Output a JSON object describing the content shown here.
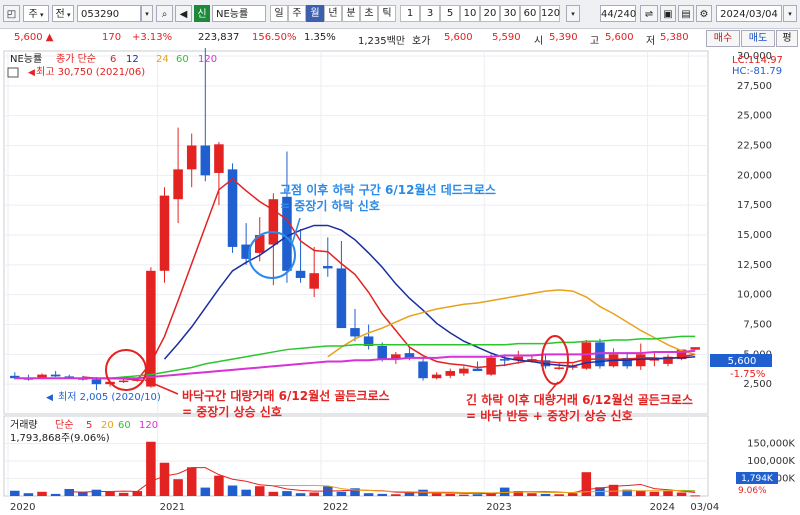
{
  "toolbar": {
    "market_label": "주",
    "total_label": "전",
    "stock_code": "053290",
    "new_label": "신",
    "stock_name": "NE능률",
    "periods": [
      "일",
      "주",
      "월",
      "년",
      "분",
      "초",
      "틱"
    ],
    "active_period": "월",
    "intervals": [
      "1",
      "3",
      "5",
      "10",
      "20",
      "30",
      "60",
      "120"
    ],
    "count_label": "44/240",
    "date_label": "2024/03/04"
  },
  "quote": {
    "price": "5,600 ▲",
    "change": "170",
    "change_pct": "+3.13%",
    "volume": "223,837",
    "volume_pct": "156.50%",
    "turnover_pct": "1.35%",
    "amount": "1,235백만",
    "bid_label": "호가",
    "bid1": "5,600",
    "bid2": "5,590",
    "open_label": "시",
    "open": "5,390",
    "high_label": "고",
    "high": "5,600",
    "low_label": "저",
    "low": "5,380",
    "buy_label": "매수",
    "sell_label": "매도",
    "ask_label": "평"
  },
  "price_panel": {
    "legend_name": "NE능률",
    "legend_ma": "종가 단순",
    "ma_labels": [
      "6",
      "12",
      "24",
      "60",
      "120"
    ],
    "max_label": "최고 30,750 (2021/06)",
    "min_label": "최저 2,005 (2020/10)",
    "lc_label": "LC:114.97",
    "hc_label": "HC:-81.79",
    "current_price_label": "5,600",
    "current_pct_label": "-1.75%"
  },
  "volume_panel": {
    "title": "거래량",
    "ma_type": "단순",
    "ma_labels": [
      "5",
      "20",
      "60",
      "120"
    ],
    "current_label": "1,793,868주(9.06%)",
    "current_tag": "1,794K",
    "current_pct_tag": "9.06%"
  },
  "annotations": {
    "top_line1": "고점 이후 하락 구간 6/12월선 데드크로스",
    "top_line2": "= 중장기 하락 신호",
    "left_line1": "바닥구간 대량거래 6/12월선 골든크로스",
    "left_line2": "= 중장기 상승 신호",
    "right_line1": "긴 하락 이후 대량거래 6/12월선 골든크로스",
    "right_line2": "= 바닥 반등 + 중장기 상승 신호"
  },
  "colors": {
    "up": "#e32222",
    "down": "#1f5fd0",
    "ma6": "#e32222",
    "ma12": "#1a2fa0",
    "ma24": "#e8a21a",
    "ma60": "#2cc52c",
    "ma120": "#d632d6",
    "annotation_blue": "#2b8ae8",
    "annotation_red": "#e32222"
  },
  "chart_data": {
    "type": "candlestick",
    "interval": "monthly",
    "price_ylim": [
      0,
      30000
    ],
    "price_yticks": [
      "2,500",
      "5,000",
      "7,500",
      "10,000",
      "12,500",
      "15,000",
      "17,500",
      "20,000",
      "22,500",
      "25,000",
      "27,500",
      "30,000"
    ],
    "price_yticks_values": [
      2500,
      5000,
      7500,
      10000,
      12500,
      15000,
      17500,
      20000,
      22500,
      25000,
      27500,
      30000
    ],
    "volume_yticks": [
      "50,000K",
      "100,000K",
      "150,000K"
    ],
    "volume_yticks_values": [
      50000,
      100000,
      150000
    ],
    "volume_ylim": [
      0,
      160000
    ],
    "x_labels": [
      "2020",
      "2021",
      "2022",
      "2023",
      "2024",
      "03/04"
    ],
    "x_label_index": [
      0,
      11,
      23,
      35,
      47,
      50
    ],
    "candles": [
      {
        "o": 3200,
        "h": 3500,
        "l": 2900,
        "c": 3000
      },
      {
        "o": 3000,
        "h": 3300,
        "l": 2800,
        "c": 2950
      },
      {
        "o": 2950,
        "h": 3400,
        "l": 2900,
        "c": 3300
      },
      {
        "o": 3300,
        "h": 3600,
        "l": 3100,
        "c": 3150
      },
      {
        "o": 3150,
        "h": 3300,
        "l": 2950,
        "c": 3000
      },
      {
        "o": 3000,
        "h": 3200,
        "l": 2800,
        "c": 2900
      },
      {
        "o": 2900,
        "h": 3100,
        "l": 2005,
        "c": 2500
      },
      {
        "o": 2500,
        "h": 2800,
        "l": 2300,
        "c": 2700
      },
      {
        "o": 2700,
        "h": 3000,
        "l": 2600,
        "c": 2800
      },
      {
        "o": 2800,
        "h": 3000,
        "l": 2700,
        "c": 2900
      },
      {
        "o": 2300,
        "h": 12300,
        "l": 2200,
        "c": 12000
      },
      {
        "o": 12000,
        "h": 19000,
        "l": 11000,
        "c": 18300
      },
      {
        "o": 18000,
        "h": 24000,
        "l": 16000,
        "c": 20500
      },
      {
        "o": 20500,
        "h": 23500,
        "l": 19000,
        "c": 22500
      },
      {
        "o": 22500,
        "h": 30750,
        "l": 19500,
        "c": 20000
      },
      {
        "o": 20200,
        "h": 22800,
        "l": 17500,
        "c": 22600
      },
      {
        "o": 20500,
        "h": 21000,
        "l": 13500,
        "c": 14000
      },
      {
        "o": 14200,
        "h": 16000,
        "l": 12500,
        "c": 13000
      },
      {
        "o": 13500,
        "h": 16500,
        "l": 12800,
        "c": 15000
      },
      {
        "o": 14200,
        "h": 18500,
        "l": 10800,
        "c": 18000
      },
      {
        "o": 18200,
        "h": 22000,
        "l": 11000,
        "c": 12000
      },
      {
        "o": 12000,
        "h": 15500,
        "l": 11000,
        "c": 11400
      },
      {
        "o": 10500,
        "h": 14000,
        "l": 9800,
        "c": 11800
      },
      {
        "o": 12400,
        "h": 14800,
        "l": 11500,
        "c": 12200
      },
      {
        "o": 12200,
        "h": 14500,
        "l": 11000,
        "c": 7200
      },
      {
        "o": 7200,
        "h": 8800,
        "l": 6100,
        "c": 6500
      },
      {
        "o": 6500,
        "h": 7500,
        "l": 5400,
        "c": 5700
      },
      {
        "o": 5700,
        "h": 6000,
        "l": 4400,
        "c": 4600
      },
      {
        "o": 4600,
        "h": 5200,
        "l": 4200,
        "c": 5000
      },
      {
        "o": 5100,
        "h": 5600,
        "l": 4500,
        "c": 4700
      },
      {
        "o": 4400,
        "h": 4800,
        "l": 2800,
        "c": 3000
      },
      {
        "o": 3000,
        "h": 3500,
        "l": 2900,
        "c": 3300
      },
      {
        "o": 3200,
        "h": 3800,
        "l": 3000,
        "c": 3600
      },
      {
        "o": 3400,
        "h": 4000,
        "l": 3200,
        "c": 3800
      },
      {
        "o": 3800,
        "h": 4400,
        "l": 3600,
        "c": 3600
      },
      {
        "o": 3300,
        "h": 5000,
        "l": 3200,
        "c": 4700
      },
      {
        "o": 4600,
        "h": 5000,
        "l": 4000,
        "c": 4500
      },
      {
        "o": 4500,
        "h": 5300,
        "l": 4200,
        "c": 4800
      },
      {
        "o": 4600,
        "h": 5000,
        "l": 4300,
        "c": 4600
      },
      {
        "o": 4500,
        "h": 5000,
        "l": 3800,
        "c": 4000
      },
      {
        "o": 3900,
        "h": 4300,
        "l": 3700,
        "c": 3900
      },
      {
        "o": 3900,
        "h": 4200,
        "l": 3700,
        "c": 4000
      },
      {
        "o": 3800,
        "h": 6200,
        "l": 3700,
        "c": 6000
      },
      {
        "o": 6000,
        "h": 6300,
        "l": 3800,
        "c": 4000
      },
      {
        "o": 4000,
        "h": 5500,
        "l": 3900,
        "c": 5000
      },
      {
        "o": 4700,
        "h": 5200,
        "l": 3800,
        "c": 4000
      },
      {
        "o": 4000,
        "h": 5900,
        "l": 3700,
        "c": 5000
      },
      {
        "o": 4500,
        "h": 5200,
        "l": 4000,
        "c": 4600
      },
      {
        "o": 4200,
        "h": 5000,
        "l": 4000,
        "c": 4800
      },
      {
        "o": 4600,
        "h": 5000,
        "l": 4500,
        "c": 5400
      },
      {
        "o": 5390,
        "h": 5600,
        "l": 5380,
        "c": 5600
      }
    ],
    "volume": [
      15,
      8,
      12,
      6,
      20,
      10,
      18,
      12,
      9,
      14,
      155,
      95,
      48,
      82,
      24,
      58,
      30,
      18,
      28,
      12,
      14,
      8,
      10,
      28,
      12,
      22,
      8,
      6,
      5,
      9,
      18,
      7,
      6,
      4,
      5,
      10,
      24,
      14,
      8,
      6,
      5,
      8,
      68,
      25,
      32,
      18,
      15,
      12,
      14,
      10,
      1.8
    ],
    "ma_series": [
      {
        "name": "6",
        "values": [
          null,
          null,
          null,
          null,
          null,
          3100,
          3000,
          2950,
          2950,
          2850,
          4300,
          6500,
          9500,
          12600,
          15700,
          18800,
          19700,
          18700,
          17800,
          17100,
          16300,
          14500,
          13700,
          13600,
          12600,
          11700,
          10200,
          8400,
          7000,
          5600,
          4900,
          4400,
          4200,
          4100,
          3900,
          4000,
          4100,
          4300,
          4500,
          4400,
          4300,
          4300,
          4600,
          4600,
          4600,
          4600,
          4700,
          4700,
          4600,
          4800,
          5000
        ]
      },
      {
        "name": "12",
        "values": [
          null,
          null,
          null,
          null,
          null,
          null,
          null,
          null,
          null,
          null,
          null,
          4600,
          5900,
          7300,
          8900,
          10500,
          12000,
          12700,
          13300,
          14100,
          14900,
          15400,
          15800,
          15800,
          15400,
          14600,
          13500,
          12300,
          10900,
          9700,
          8700,
          7600,
          6800,
          6100,
          5600,
          5100,
          4700,
          4500,
          4400,
          4200,
          4100,
          4000,
          4300,
          4400,
          4500,
          4500,
          4600,
          4600,
          4700,
          4700,
          4800
        ]
      },
      {
        "name": "24",
        "values": [
          null,
          null,
          null,
          null,
          null,
          null,
          null,
          null,
          null,
          null,
          null,
          null,
          null,
          null,
          null,
          null,
          null,
          null,
          null,
          null,
          null,
          null,
          null,
          4800,
          5600,
          6300,
          6800,
          7200,
          7700,
          8200,
          8500,
          8800,
          9000,
          9200,
          9300,
          9500,
          9700,
          9900,
          10100,
          10300,
          10400,
          10300,
          9800,
          9000,
          8400,
          7700,
          7000,
          6400,
          5800,
          5300,
          5000
        ]
      },
      {
        "name": "60",
        "values": [
          null,
          null,
          null,
          null,
          null,
          null,
          3000,
          3000,
          3100,
          3200,
          3300,
          3500,
          3700,
          3900,
          4200,
          4400,
          4600,
          4800,
          5000,
          5200,
          5400,
          5500,
          5600,
          5700,
          5700,
          5800,
          5800,
          5800,
          5800,
          5800,
          5800,
          5800,
          5800,
          5800,
          5800,
          5800,
          5800,
          5900,
          5900,
          5900,
          6000,
          6000,
          6100,
          6100,
          6200,
          6200,
          6300,
          6300,
          6400,
          6500,
          6500
        ]
      },
      {
        "name": "120",
        "values": [
          3000,
          3000,
          3000,
          3000,
          3000,
          3000,
          3000,
          3000,
          3000,
          3000,
          3100,
          3200,
          3300,
          3400,
          3500,
          3600,
          3700,
          3800,
          3900,
          4000,
          4100,
          4200,
          4300,
          4400,
          4400,
          4500,
          4500,
          4600,
          4600,
          4700,
          4700,
          4700,
          4800,
          4800,
          4800,
          4800,
          4900,
          4900,
          4900,
          5000,
          5000,
          5000,
          5000,
          5100,
          5100,
          5100,
          5100,
          5200,
          5200,
          5200,
          5300
        ]
      }
    ],
    "vol_ma_series": [
      {
        "name": "5",
        "values": [
          null,
          null,
          null,
          null,
          12,
          11,
          13,
          13,
          14,
          13,
          42,
          57,
          64,
          81,
          81,
          61,
          48,
          42,
          32,
          29,
          20,
          16,
          14,
          14,
          15,
          17,
          16,
          15,
          11,
          10,
          9,
          9,
          9,
          8,
          8,
          6,
          10,
          12,
          12,
          12,
          11,
          9,
          19,
          22,
          28,
          30,
          33,
          21,
          18,
          14,
          10
        ]
      },
      {
        "name": "20",
        "values": [
          null,
          null,
          null,
          null,
          null,
          null,
          null,
          null,
          null,
          null,
          null,
          null,
          null,
          null,
          null,
          null,
          null,
          null,
          null,
          30,
          30,
          30,
          30,
          29,
          21,
          17,
          16,
          14,
          13,
          12,
          11,
          11,
          11,
          10,
          10,
          9,
          10,
          11,
          11,
          10,
          10,
          10,
          12,
          13,
          14,
          15,
          15,
          15,
          15,
          16,
          15
        ]
      },
      {
        "name": "60",
        "values": [
          null,
          null,
          null,
          null,
          null,
          null,
          null,
          null,
          null,
          null,
          null,
          null,
          null,
          null,
          null,
          null,
          null,
          null,
          null,
          null,
          null,
          null,
          null,
          null,
          null,
          null,
          null,
          null,
          null,
          null,
          null,
          null,
          null,
          null,
          null,
          null,
          null,
          null,
          null,
          null,
          null,
          null,
          null,
          null,
          null,
          null,
          null,
          null,
          null,
          14,
          14
        ]
      },
      {
        "name": "120",
        "values": []
      }
    ]
  }
}
